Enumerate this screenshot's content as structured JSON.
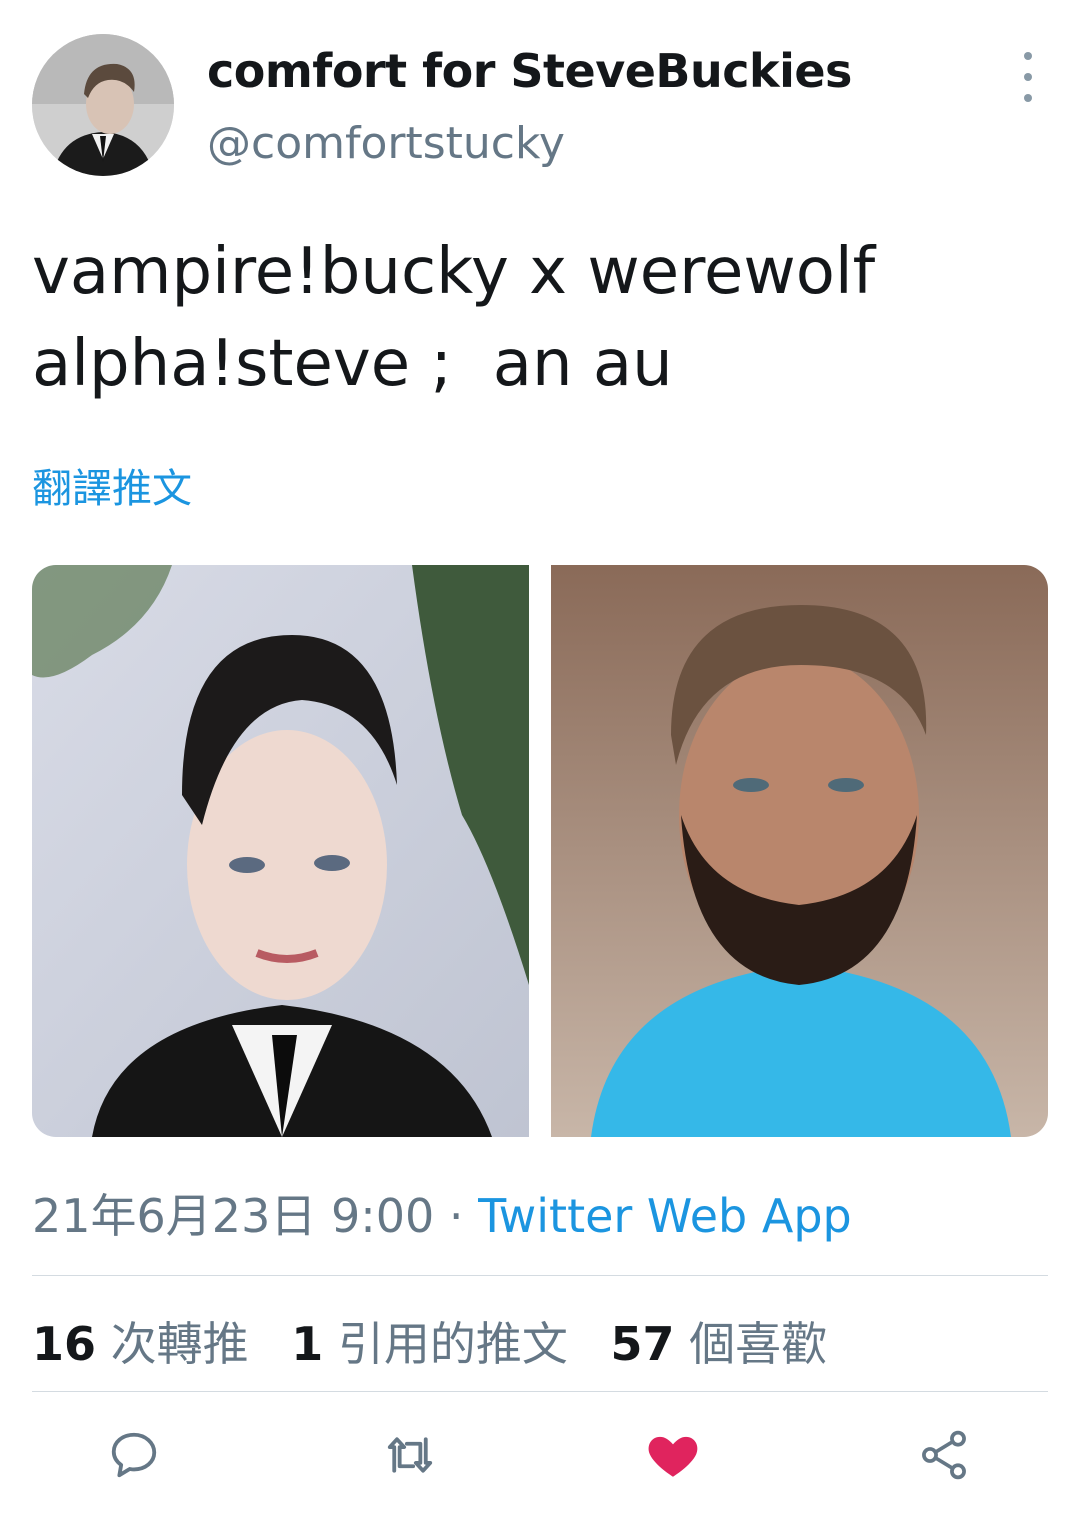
{
  "author": {
    "display_name": "comfort for SteveBuckies",
    "handle": "@comfortstucky"
  },
  "tweet": {
    "text": "vampire!bucky x werewolf\nalpha!steve ;  an au",
    "translate_label": "翻譯推文"
  },
  "media": [
    {
      "description": "photo-left"
    },
    {
      "description": "photo-right"
    }
  ],
  "meta": {
    "timestamp": "21年6月23日 9:00",
    "separator": " · ",
    "source": "Twitter Web App"
  },
  "stats": {
    "retweets_count": "16",
    "retweets_label": "次轉推",
    "quotes_count": "1",
    "quotes_label": "引用的推文",
    "likes_count": "57",
    "likes_label": "個喜歡"
  },
  "actions": {
    "reply_icon": "reply-icon",
    "retweet_icon": "retweet-icon",
    "like_icon": "heart-icon",
    "share_icon": "share-icon"
  },
  "colors": {
    "accent": "#1b95e0",
    "like": "#e0245e",
    "secondary_text": "#657786",
    "action_icon": "#657786"
  }
}
